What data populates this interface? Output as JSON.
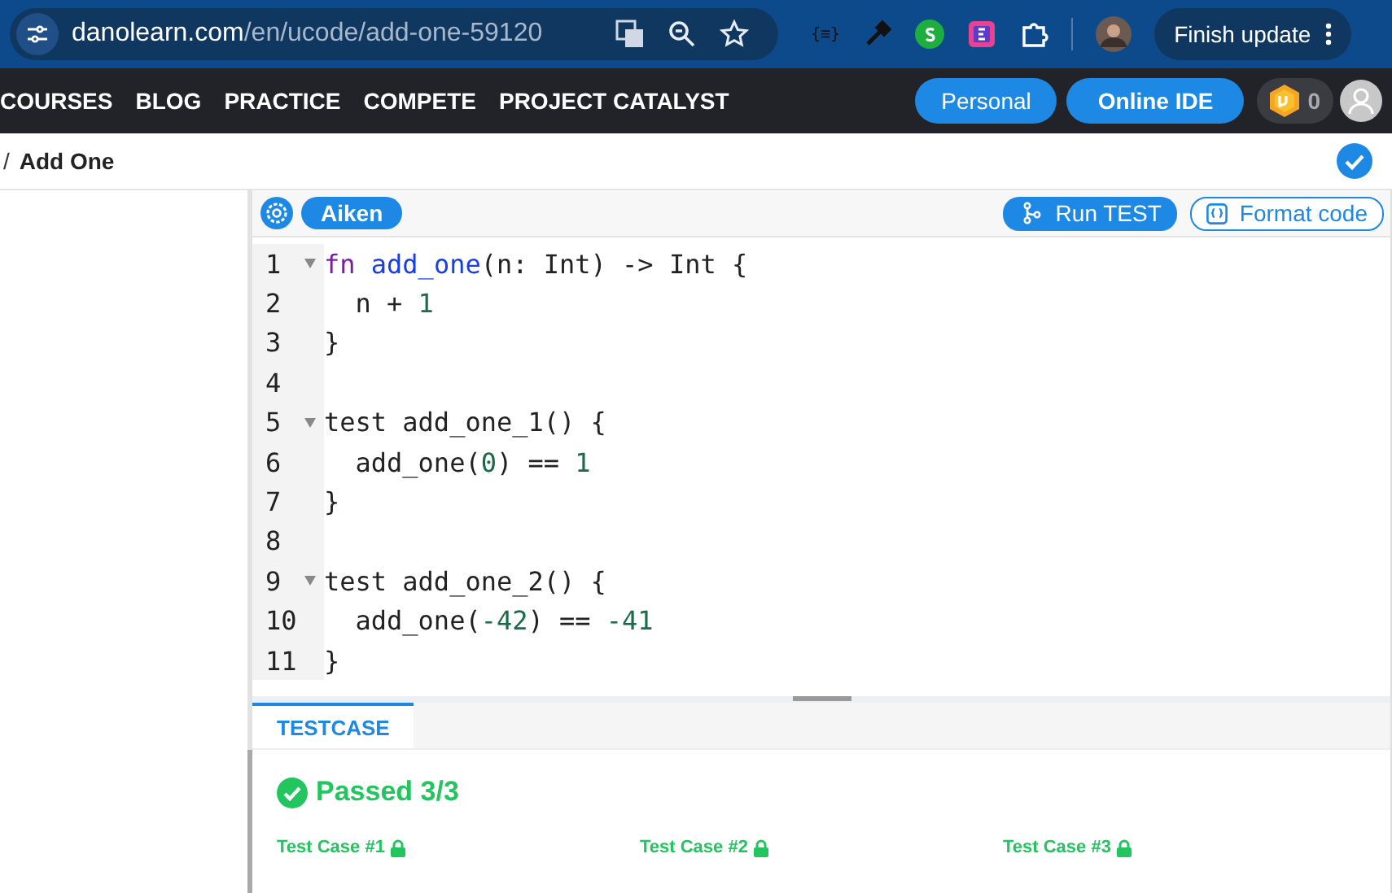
{
  "browser": {
    "url_host": "danolearn.com",
    "url_path": "/en/ucode/add-one-59120",
    "update_button": "Finish update",
    "extension_label": "{≡}"
  },
  "nav": {
    "items": [
      "COURSES",
      "BLOG",
      "PRACTICE",
      "COMPETE",
      "PROJECT CATALYST"
    ],
    "personal_button": "Personal",
    "ide_button": "Online IDE",
    "coins": "0"
  },
  "breadcrumb": {
    "separator": "/",
    "title": "Add One",
    "completed": true
  },
  "editor": {
    "language": "Aiken",
    "run_button": "Run TEST",
    "format_button": "Format code",
    "lines": [
      {
        "number": "1",
        "foldable": true,
        "tokens": [
          {
            "kind": "keyword",
            "text": "fn "
          },
          {
            "kind": "function",
            "text": "add_one"
          },
          {
            "kind": "plain",
            "text": "(n: Int) -> Int {"
          }
        ]
      },
      {
        "number": "2",
        "foldable": false,
        "tokens": [
          {
            "kind": "plain",
            "text": "  n + "
          },
          {
            "kind": "number",
            "text": "1"
          }
        ]
      },
      {
        "number": "3",
        "foldable": false,
        "tokens": [
          {
            "kind": "plain",
            "text": "}"
          }
        ]
      },
      {
        "number": "4",
        "foldable": false
      },
      {
        "number": "5",
        "foldable": true,
        "tokens": [
          {
            "kind": "plain",
            "text": "test add_one_1() {"
          }
        ]
      },
      {
        "number": "6",
        "foldable": false,
        "tokens": [
          {
            "kind": "plain",
            "text": "  add_one("
          },
          {
            "kind": "number",
            "text": "0"
          },
          {
            "kind": "plain",
            "text": ") == "
          },
          {
            "kind": "number",
            "text": "1"
          }
        ]
      },
      {
        "number": "7",
        "foldable": false,
        "tokens": [
          {
            "kind": "plain",
            "text": "}"
          }
        ]
      },
      {
        "number": "8",
        "foldable": false
      },
      {
        "number": "9",
        "foldable": true,
        "tokens": [
          {
            "kind": "plain",
            "text": "test add_one_2() {"
          }
        ]
      },
      {
        "number": "10",
        "foldable": false,
        "tokens": [
          {
            "kind": "plain",
            "text": "  add_one("
          },
          {
            "kind": "number",
            "text": "-42"
          },
          {
            "kind": "plain",
            "text": ") == "
          },
          {
            "kind": "number",
            "text": "-41"
          }
        ]
      },
      {
        "number": "11",
        "foldable": false,
        "tokens": [
          {
            "kind": "plain",
            "text": "}"
          }
        ]
      }
    ]
  },
  "results": {
    "tabs": [
      {
        "label": "TESTCASE",
        "selected": true
      }
    ],
    "summary": "Passed 3/3",
    "passed": true,
    "cases": [
      {
        "label": "Test Case #1",
        "locked": true
      },
      {
        "label": "Test Case #2",
        "locked": true
      },
      {
        "label": "Test Case #3",
        "locked": true
      }
    ]
  }
}
